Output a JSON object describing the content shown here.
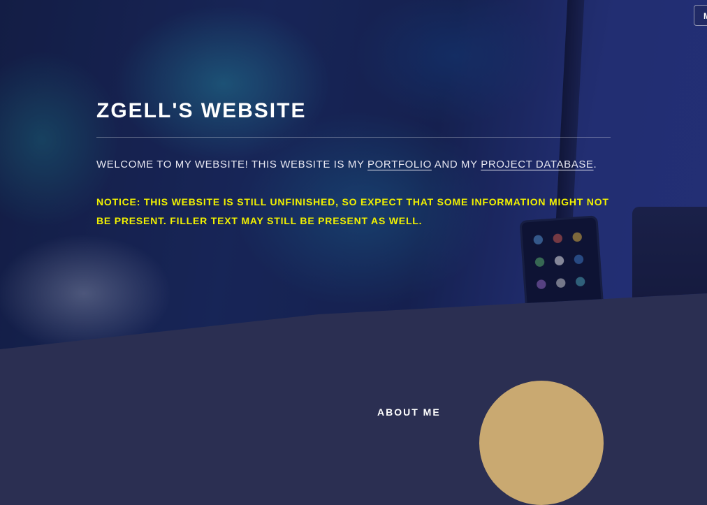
{
  "nav": {
    "menu_label": "M"
  },
  "hero": {
    "title": "ZGELL'S WEBSITE",
    "intro_prefix": "WELCOME TO MY WEBSITE! THIS WEBSITE IS MY ",
    "portfolio_link": "PORTFOLIO",
    "intro_middle": " AND MY ",
    "database_link": "PROJECT DATABASE",
    "intro_suffix": ".",
    "notice": "NOTICE: THIS WEBSITE IS STILL UNFINISHED, SO EXPECT THAT SOME INFORMATION MIGHT NOT BE PRESENT. FILLER TEXT MAY STILL BE PRESENT AS WELL."
  },
  "about": {
    "heading": "ABOUT ME"
  },
  "colors": {
    "notice": "#f2f200",
    "background": "#2b2f52",
    "avatar": "#c9a971"
  }
}
